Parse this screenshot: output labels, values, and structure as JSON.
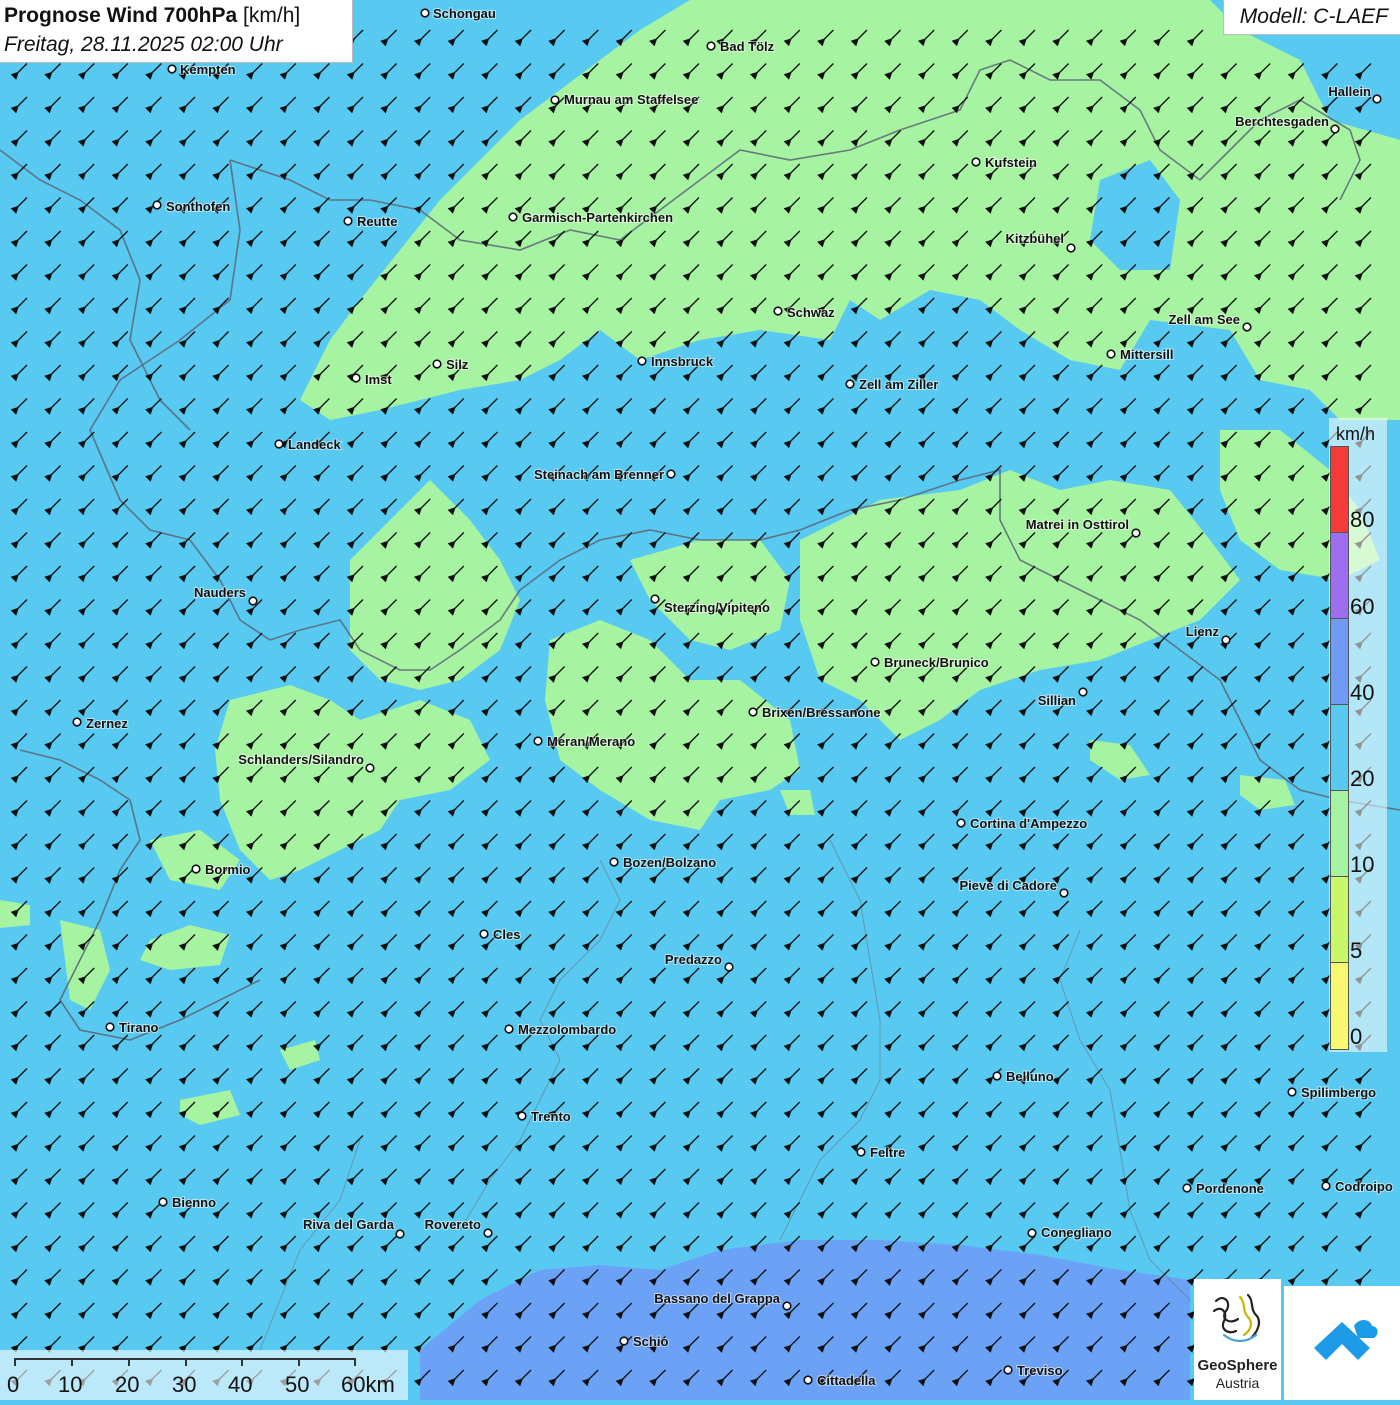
{
  "header": {
    "title_bold": "Prognose Wind 700hPa",
    "title_unit": "[km/h]",
    "datetime": "Freitag, 28.11.2025 02:00 Uhr",
    "model": "Modell: C-LAEF"
  },
  "colors": {
    "calm_0_5": "#f9f871",
    "light_5_10": "#c8f76a",
    "moderate_10_20": "#a6f3a2",
    "fresh_20_40": "#58c9f0",
    "strong_40_60": "#6f9bf7",
    "gale_60_80": "#9d6ef0",
    "storm_80_plus": "#f53a3a",
    "land": "#58c9f0"
  },
  "legend": {
    "unit": "km/h",
    "ticks": [
      "80",
      "60",
      "40",
      "20",
      "10",
      "5",
      "0"
    ]
  },
  "scale_bar": {
    "labels": [
      "0",
      "10",
      "20",
      "30",
      "40",
      "50",
      "60km"
    ]
  },
  "wind_direction": "from northeast",
  "cities": [
    {
      "name": "Schongau"
    },
    {
      "name": "Bad Tölz"
    },
    {
      "name": "Kempten"
    },
    {
      "name": "Murnau am Staffelsee"
    },
    {
      "name": "Hallein"
    },
    {
      "name": "Berchtesgaden"
    },
    {
      "name": "Kufstein"
    },
    {
      "name": "Sonthofen"
    },
    {
      "name": "Reutte"
    },
    {
      "name": "Garmisch-Partenkirchen"
    },
    {
      "name": "Kitzbühel"
    },
    {
      "name": "Schwaz"
    },
    {
      "name": "Zell am See"
    },
    {
      "name": "Mittersill"
    },
    {
      "name": "Silz"
    },
    {
      "name": "Innsbruck"
    },
    {
      "name": "Imst"
    },
    {
      "name": "Zell am Ziller"
    },
    {
      "name": "Landeck"
    },
    {
      "name": "Steinach am Brenner"
    },
    {
      "name": "Matrei in Osttirol"
    },
    {
      "name": "Nauders"
    },
    {
      "name": "Sterzing/Vipiteno"
    },
    {
      "name": "Lienz"
    },
    {
      "name": "Bruneck/Brunico"
    },
    {
      "name": "Sillian"
    },
    {
      "name": "Zernez"
    },
    {
      "name": "Brixen/Bressanone"
    },
    {
      "name": "Meran/Merano"
    },
    {
      "name": "Schlanders/Silandro"
    },
    {
      "name": "Cortina d'Ampezzo"
    },
    {
      "name": "Bozen/Bolzano"
    },
    {
      "name": "Bormio"
    },
    {
      "name": "Pieve di Cadore"
    },
    {
      "name": "Cles"
    },
    {
      "name": "Predazzo"
    },
    {
      "name": "Tirano"
    },
    {
      "name": "Mezzolombardo"
    },
    {
      "name": "Belluno"
    },
    {
      "name": "Spilimbergo"
    },
    {
      "name": "Trento"
    },
    {
      "name": "Feltre"
    },
    {
      "name": "Pordenone"
    },
    {
      "name": "Codroipo"
    },
    {
      "name": "Bienno"
    },
    {
      "name": "Riva del Garda"
    },
    {
      "name": "Rovereto"
    },
    {
      "name": "Conegliano"
    },
    {
      "name": "Bassano del Grappa"
    },
    {
      "name": "Schio"
    },
    {
      "name": "Treviso"
    },
    {
      "name": "Cittadella"
    }
  ],
  "logos": {
    "geosphere_line1": "GeoSphere",
    "geosphere_line2": "Austria"
  }
}
